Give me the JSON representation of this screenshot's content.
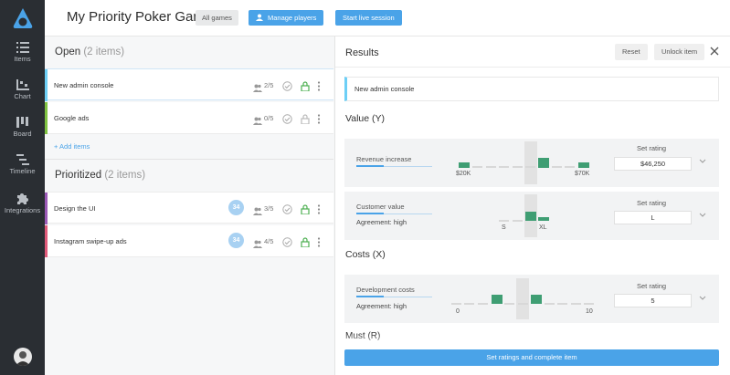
{
  "sidebar": {
    "items": [
      {
        "label": "Items",
        "icon": "list-icon"
      },
      {
        "label": "Chart",
        "icon": "chart-icon"
      },
      {
        "label": "Board",
        "icon": "board-icon"
      },
      {
        "label": "Timeline",
        "icon": "timeline-icon"
      },
      {
        "label": "Integrations",
        "icon": "puzzle-icon"
      }
    ]
  },
  "header": {
    "title": "My Priority Poker Game",
    "all_games": "All games",
    "manage_players": "Manage players",
    "start_session": "Start live session"
  },
  "open": {
    "title": "Open",
    "count": "(2 items)",
    "items": [
      {
        "name": "New admin console",
        "votes": "2/5",
        "color": "#6dcff6"
      },
      {
        "name": "Google ads",
        "votes": "0/5",
        "color": "#7fc241"
      }
    ],
    "add_label": "+ Add items"
  },
  "prioritized": {
    "title": "Prioritized",
    "count": "(2 items)",
    "items": [
      {
        "name": "Design the UI",
        "votes": "3/5",
        "score": "34",
        "color": "#9b59b6"
      },
      {
        "name": "Instagram swipe-up ads",
        "votes": "4/5",
        "score": "34",
        "color": "#e05a7a"
      }
    ]
  },
  "results": {
    "title": "Results",
    "reset": "Reset",
    "unlock": "Unlock item",
    "item_name": "New admin console",
    "value_heading": "Value (Y)",
    "costs_heading": "Costs (X)",
    "must_heading": "Must (R)",
    "revenue": {
      "label": "Revenue increase",
      "min": "$20K",
      "max": "$70K",
      "set_rating": "Set rating",
      "value": "$46,250"
    },
    "customer": {
      "label": "Customer value",
      "agreement": "Agreement: high",
      "min": "S",
      "max": "XL",
      "set_rating": "Set rating",
      "value": "L"
    },
    "dev": {
      "label": "Development costs",
      "agreement": "Agreement: high",
      "min": "0",
      "max": "10",
      "set_rating": "Set rating",
      "value": "5"
    },
    "complete": "Set ratings and complete item"
  },
  "colors": {
    "accent": "#4aa3e8",
    "sidebar": "#2a2e33",
    "vote_bar": "#3f9e73"
  }
}
